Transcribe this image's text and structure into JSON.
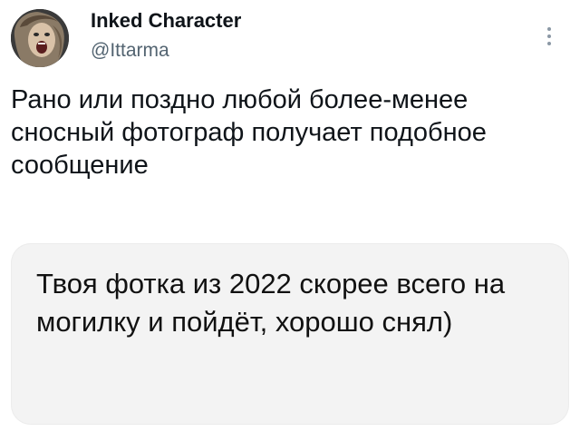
{
  "tweet": {
    "author_name": "Inked Character",
    "author_handle": "@Ittarma",
    "text": "Рано или поздно любой более-менее сносный фотограф получает подобное сообщение",
    "avatar_icon": "person-screaming-avatar",
    "more_icon": "vertical-ellipsis-icon"
  },
  "attached_message": {
    "text": "Твоя фотка из 2022 скорее всего на могилку и пойдёт, хорошо снял)"
  }
}
